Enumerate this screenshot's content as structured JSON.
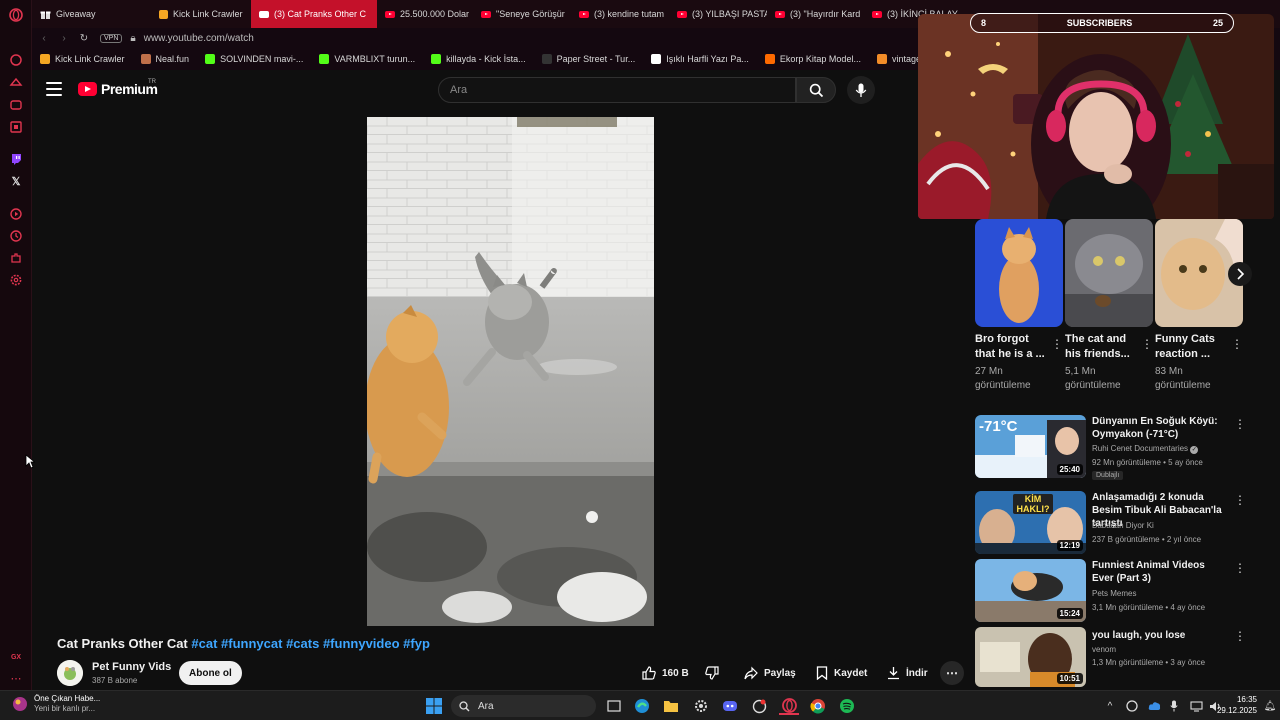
{
  "browser": {
    "tabs": [
      {
        "label": "Giveaway",
        "icon": "gift-icon",
        "active": false
      },
      {
        "label": "Kick Link Crawler",
        "icon": "kick-icon",
        "active": false
      },
      {
        "label": "(3) Cat Pranks Other C",
        "icon": "youtube-icon",
        "active": true
      },
      {
        "label": "25.500.000 Dolar",
        "icon": "youtube-icon",
        "active": false
      },
      {
        "label": "\"Seneye Görüşür",
        "icon": "youtube-icon",
        "active": false
      },
      {
        "label": "(3) kendine tutam",
        "icon": "youtube-icon",
        "active": false
      },
      {
        "label": "(3) YILBAŞI PASTA",
        "icon": "youtube-icon",
        "active": false
      },
      {
        "label": "(3) \"Hayırdır Kard",
        "icon": "youtube-icon",
        "active": false
      },
      {
        "label": "(3) İKİNCİ BALAY",
        "icon": "youtube-icon",
        "active": false
      }
    ],
    "vpn_label": "VPN",
    "url": "www.youtube.com/watch",
    "bookmarks": [
      {
        "label": "Kick Link Crawler",
        "color": "#f5a623"
      },
      {
        "label": "Neal.fun",
        "color": "#c0704a"
      },
      {
        "label": "SOLVINDEN mavi-...",
        "color": "#53fc18"
      },
      {
        "label": "VARMBLIXT turun...",
        "color": "#53fc18"
      },
      {
        "label": "killayda - Kick İsta...",
        "color": "#53fc18"
      },
      {
        "label": "Paper Street - Tur...",
        "color": "#333333"
      },
      {
        "label": "Işıklı Harfli Yazı Pa...",
        "color": "#ffffff"
      },
      {
        "label": "Ekorp Kitap Model...",
        "color": "#ff6a00"
      },
      {
        "label": "vintage esintili vini...",
        "color": "#f28c28"
      }
    ]
  },
  "youtube": {
    "logo_text": "Premium",
    "logo_region": "TR",
    "search_placeholder": "Ara",
    "video": {
      "title_main": "Cat Pranks Other Cat",
      "hashtags": [
        "#cat",
        "#funnycat",
        "#cats",
        "#funnyvideo",
        "#fyp"
      ],
      "channel": "Pet Funny Vids",
      "subscribers": "387 B abone",
      "subscribe_label": "Abone ol",
      "likes": "160 B",
      "share_label": "Paylaş",
      "save_label": "Kaydet",
      "download_label": "İndir"
    },
    "overlay": {
      "subscribers_label": "SUBSCRIBERS",
      "count_left": "8",
      "count_right": "25"
    },
    "shorts": [
      {
        "title": "Bro forgot that he is a ...",
        "views": "27 Mn görüntüleme"
      },
      {
        "title": "The cat and his friends...",
        "views": "5,1 Mn görüntüleme"
      },
      {
        "title": "Funny Cats reaction ...",
        "views": "83 Mn görüntüleme"
      }
    ],
    "related": [
      {
        "title": "Dünyanın En Soğuk Köyü: Oymyakon (-71°C)",
        "channel": "Ruhi Cenet Documentaries",
        "verified": true,
        "meta": "92 Mn görüntüleme • 5 ay önce",
        "badge": "Dublajlı",
        "duration": "25:40",
        "thumb_text": "-71°C"
      },
      {
        "title": "Anlaşamadığı 2 konuda Besim Tibuk Ali Babacan'la tartıştı",
        "channel": "Babacan Diyor Ki",
        "verified": false,
        "meta": "237 B görüntüleme • 2 yıl önce",
        "badge": "",
        "duration": "12:19",
        "thumb_text": "KİM HAKLI?"
      },
      {
        "title": "Funniest Animal Videos Ever (Part 3)",
        "channel": "Pets Memes",
        "verified": false,
        "meta": "3,1 Mn görüntüleme • 4 ay önce",
        "badge": "",
        "duration": "15:24",
        "thumb_text": ""
      },
      {
        "title": "you laugh, you lose",
        "channel": "venom",
        "verified": false,
        "meta": "1,3 Mn görüntüleme • 3 ay önce",
        "badge": "",
        "duration": "10:51",
        "thumb_text": ""
      }
    ]
  },
  "taskbar": {
    "news_title": "Öne Çıkan Habe...",
    "news_sub": "Yeni bir kanlı pr...",
    "search_placeholder": "Ara",
    "time": "16:35",
    "date": "29.12.2025"
  }
}
